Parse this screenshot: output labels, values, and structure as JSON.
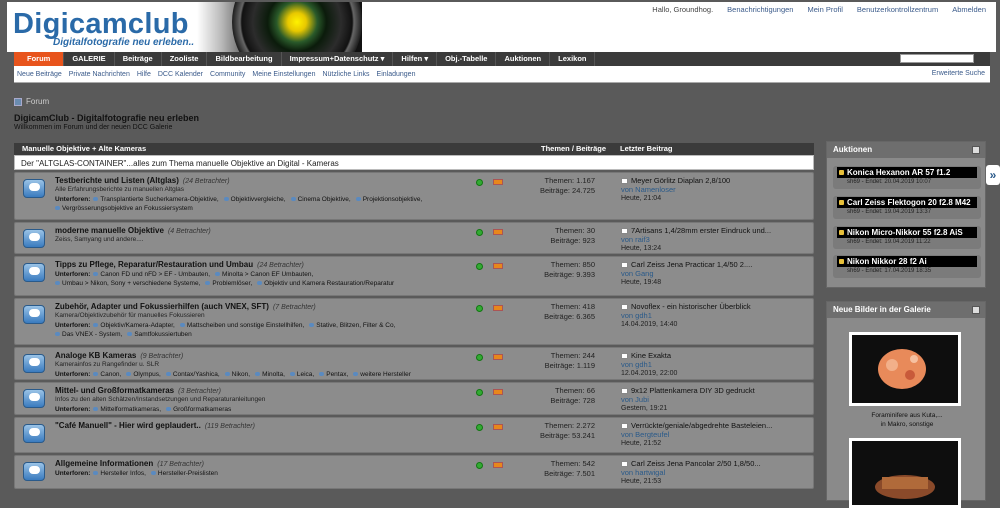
{
  "header": {
    "logo": "Digicamclub",
    "tagline": "Digitalfotografie neu erleben..",
    "toplinks": [
      "Hallo, Groundhog.",
      "Benachrichtigungen",
      "Mein Profil",
      "Benutzerkontrollzentrum",
      "Abmelden"
    ]
  },
  "nav": [
    "Forum",
    "GALERIE",
    "Beiträge",
    "Zooliste",
    "Bildbearbeitung",
    "Impressum+Datenschutz ▾",
    "Hilfen ▾",
    "Obj.-Tabelle",
    "Auktionen",
    "Lexikon"
  ],
  "subnav": [
    "Neue Beiträge",
    "Private Nachrichten",
    "Hilfe",
    "DCC Kalender",
    "Community",
    "Meine Einstellungen",
    "Nützliche Links",
    "Einladungen"
  ],
  "subnav_right": "Erweiterte Suche",
  "breadcrumb": "Forum",
  "page_title": "DigicamClub - Digitalfotografie neu erleben",
  "welcome": "Willkommen im Forum und der neuen DCC Galerie",
  "forum_head": {
    "c1": "Manuelle Objektive + Alte Kameras",
    "c2": "Themen / Beiträge",
    "c3": "Letzter Beitrag"
  },
  "forum_desc": "Der \"ALTGLAS-CONTAINER\"...alles zum Thema manuelle Objektive an Digital - Kameras",
  "forums": [
    {
      "title": "Testberichte und Listen (Altglas)",
      "viewers": "(24 Betrachter)",
      "desc": "Alle Erfahrungsberichte zu manuellen Altglas",
      "sub_label": "Unterforen:",
      "subs": [
        "Transplantierte Sucherkamera-Objektive,",
        "Objektivvergleiche,",
        "Cinema Objektive,",
        "Projektionsobjektive,",
        "Vergrösserungsobjektive an Fokussiersystem"
      ],
      "themen": "Themen: 1.167",
      "beitraege": "Beiträge: 24.725",
      "last_title": "Meyer Görlitz Diaplan 2,8/100",
      "last_user": "von Namenloser",
      "last_date": "Heute, 21:04"
    },
    {
      "title": "moderne manuelle Objektive",
      "viewers": "(4 Betrachter)",
      "desc": "Zeiss, Samyang und andere....",
      "sub_label": "",
      "subs": [],
      "themen": "Themen: 30",
      "beitraege": "Beiträge: 923",
      "last_title": "7Artisans 1,4/28mm erster Eindruck und...",
      "last_user": "von raif3",
      "last_date": "Heute, 13:24"
    },
    {
      "title": "Tipps zu Pflege, Reparatur/Restauration und Umbau",
      "viewers": "(24 Betrachter)",
      "desc": "",
      "sub_label": "Unterforen:",
      "subs": [
        "Canon FD und nFD > EF - Umbauten,",
        "Minolta > Canon EF Umbauten,",
        "Umbau > Nikon, Sony + verschiedene Systeme,",
        "Problemlöser,",
        "Objektiv und Kamera Restauration/Reparatur"
      ],
      "themen": "Themen: 850",
      "beitraege": "Beiträge: 9.393",
      "last_title": "Carl Zeiss Jena Practicar 1,4/50 2....",
      "last_user": "von Gang",
      "last_date": "Heute, 19:48"
    },
    {
      "title": "Zubehör, Adapter und Fokussierhilfen (auch VNEX, SFT)",
      "viewers": "(7 Betrachter)",
      "desc": "Kamera/Objektivzubehör für manuelles Fokussieren",
      "sub_label": "Unterforen:",
      "subs": [
        "Objektiv/Kamera-Adapter,",
        "Mattscheiben und sonstige Einstellhilfen,",
        "Stative, Blitzen, Filter & Co,",
        "Das VNEX - System,",
        "Samtfokussiertuben"
      ],
      "themen": "Themen: 418",
      "beitraege": "Beiträge: 6.365",
      "last_title": "Novoflex - ein historischer Überblick",
      "last_user": "von gdh1",
      "last_date": "14.04.2019, 14:40"
    },
    {
      "title": "Analoge KB Kameras",
      "viewers": "(9 Betrachter)",
      "desc": "Kamerainfos zu Rangefinder u. SLR",
      "sub_label": "Unterforen:",
      "subs": [
        "Canon,",
        "Olympus,",
        "Contax/Yashica,",
        "Nikon,",
        "Minolta,",
        "Leica,",
        "Pentax,",
        "weitere Hersteller"
      ],
      "themen": "Themen: 244",
      "beitraege": "Beiträge: 1.119",
      "last_title": "Kine Exakta",
      "last_user": "von gdh1",
      "last_date": "12.04.2019, 22:00"
    },
    {
      "title": "Mittel- und Großformatkameras",
      "viewers": "(3 Betrachter)",
      "desc": "Infos zu den alten Schätzen/Instandsetzungen und Reparaturanleitungen",
      "sub_label": "Unterforen:",
      "subs": [
        "Mittelformatkameras,",
        "Großformatkameras"
      ],
      "themen": "Themen: 66",
      "beitraege": "Beiträge: 728",
      "last_title": "9x12 Plattenkamera DIY 3D gedruckt",
      "last_user": "von Jubi",
      "last_date": "Gestern, 19:21"
    },
    {
      "title": "\"Café Manuell\" - Hier wird geplaudert..",
      "viewers": "(119 Betrachter)",
      "desc": "",
      "sub_label": "",
      "subs": [],
      "themen": "Themen: 2.272",
      "beitraege": "Beiträge: 53.241",
      "last_title": "Verrückte/geniale/abgedrehte Basteleien...",
      "last_user": "von Bergteufel",
      "last_date": "Heute, 21:52"
    },
    {
      "title": "Allgemeine Informationen",
      "viewers": "(17 Betrachter)",
      "desc": "",
      "sub_label": "Unterforen:",
      "subs": [
        "Hersteller Infos,",
        "Hersteller-Preislisten"
      ],
      "themen": "Themen: 542",
      "beitraege": "Beiträge: 7.501",
      "last_title": "Carl Zeiss Jena Pancolar 2/50 1,8/50...",
      "last_user": "von hartwigal",
      "last_date": "Heute, 21:53"
    }
  ],
  "sidebar": {
    "auctions_title": "Auktionen",
    "auctions": [
      {
        "name": "Konica Hexanon AR 57 f1.2",
        "meta": "sh69 - Endet: 20.04.2019 10:07"
      },
      {
        "name": "Carl Zeiss Flektogon 20 f2.8 M42",
        "meta": "sh69 - Endet: 19.04.2019 13:37"
      },
      {
        "name": "Nikon Micro-Nikkor 55 f2.8 AiS",
        "meta": "sh69 - Endet: 19.04.2019 11:22"
      },
      {
        "name": "Nikon Nikkor 28 f2 Ai",
        "meta": "sh69 - Endet: 17.04.2019 18:35"
      }
    ],
    "gallery_title": "Neue Bilder in der Galerie",
    "gallery_caption1": "Foraminifere aus Kuta,...",
    "gallery_caption2": "in Makro, sonstige"
  }
}
